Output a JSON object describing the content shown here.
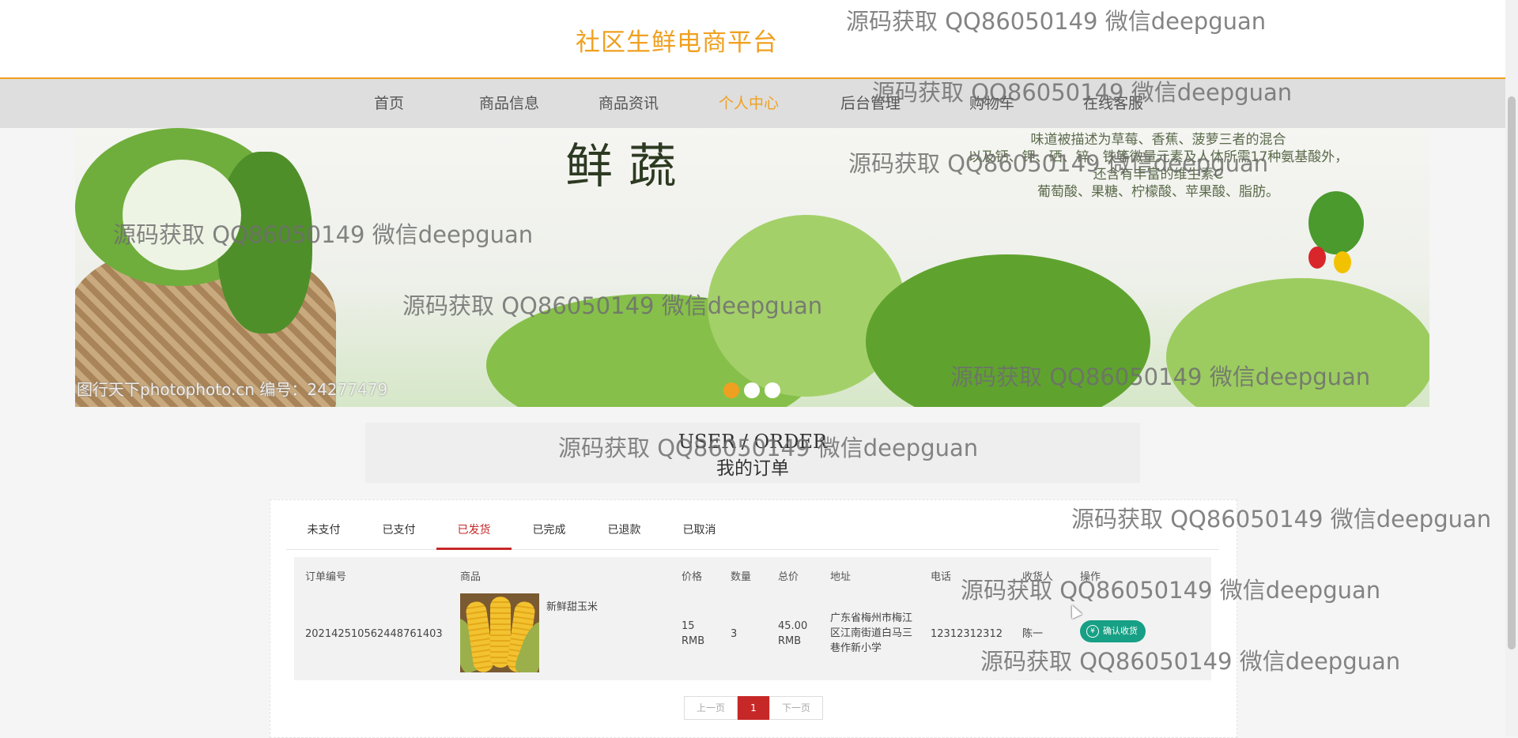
{
  "header": {
    "site_title": "社区生鲜电商平台"
  },
  "nav": {
    "items": [
      {
        "label": "首页"
      },
      {
        "label": "商品信息"
      },
      {
        "label": "商品资讯"
      },
      {
        "label": "个人中心"
      },
      {
        "label": "后台管理"
      },
      {
        "label": "购物车"
      },
      {
        "label": "在线客服"
      }
    ],
    "active_index": 3
  },
  "banner": {
    "brush_text": "鲜蔬",
    "text_lines": [
      "味道被描述为草莓、香蕉、菠萝三者的混合",
      "以及钙、钾、硒、锌、铁等微量元素及人体所需17种氨基酸外，",
      "还含有丰富的维生素C",
      "葡萄酸、果糖、柠檬酸、苹果酸、脂肪。"
    ],
    "credit": "图行天下photophoto.cn  编号：24277479",
    "slide_count": 3,
    "active_slide": 0
  },
  "order_section": {
    "title_en": "USER / ORDER",
    "title_cn": "我的订单"
  },
  "tabs": [
    {
      "label": "未支付"
    },
    {
      "label": "已支付"
    },
    {
      "label": "已发货"
    },
    {
      "label": "已完成"
    },
    {
      "label": "已退款"
    },
    {
      "label": "已取消"
    }
  ],
  "active_tab": 2,
  "table": {
    "headers": [
      "订单编号",
      "商品",
      "价格",
      "数量",
      "总价",
      "地址",
      "电话",
      "收货人",
      "操作"
    ],
    "rows": [
      {
        "order_no": "202142510562448761403",
        "product": "新鲜甜玉米",
        "price": "15 RMB",
        "quantity": "3",
        "total": "45.00 RMB",
        "address": "广东省梅州市梅江区江南街道白马三巷作新小学",
        "phone": "12312312312",
        "receiver": "陈一",
        "action": "确认收货"
      }
    ]
  },
  "pager": {
    "prev": "上一页",
    "current": "1",
    "next": "下一页"
  },
  "watermark": "源码获取 QQ86050149 微信deepguan",
  "colors": {
    "accent": "#f0a020",
    "active_tab": "#c62828",
    "confirm_button": "#17a085"
  },
  "icons": {
    "confirm": "yen-circle-icon"
  }
}
